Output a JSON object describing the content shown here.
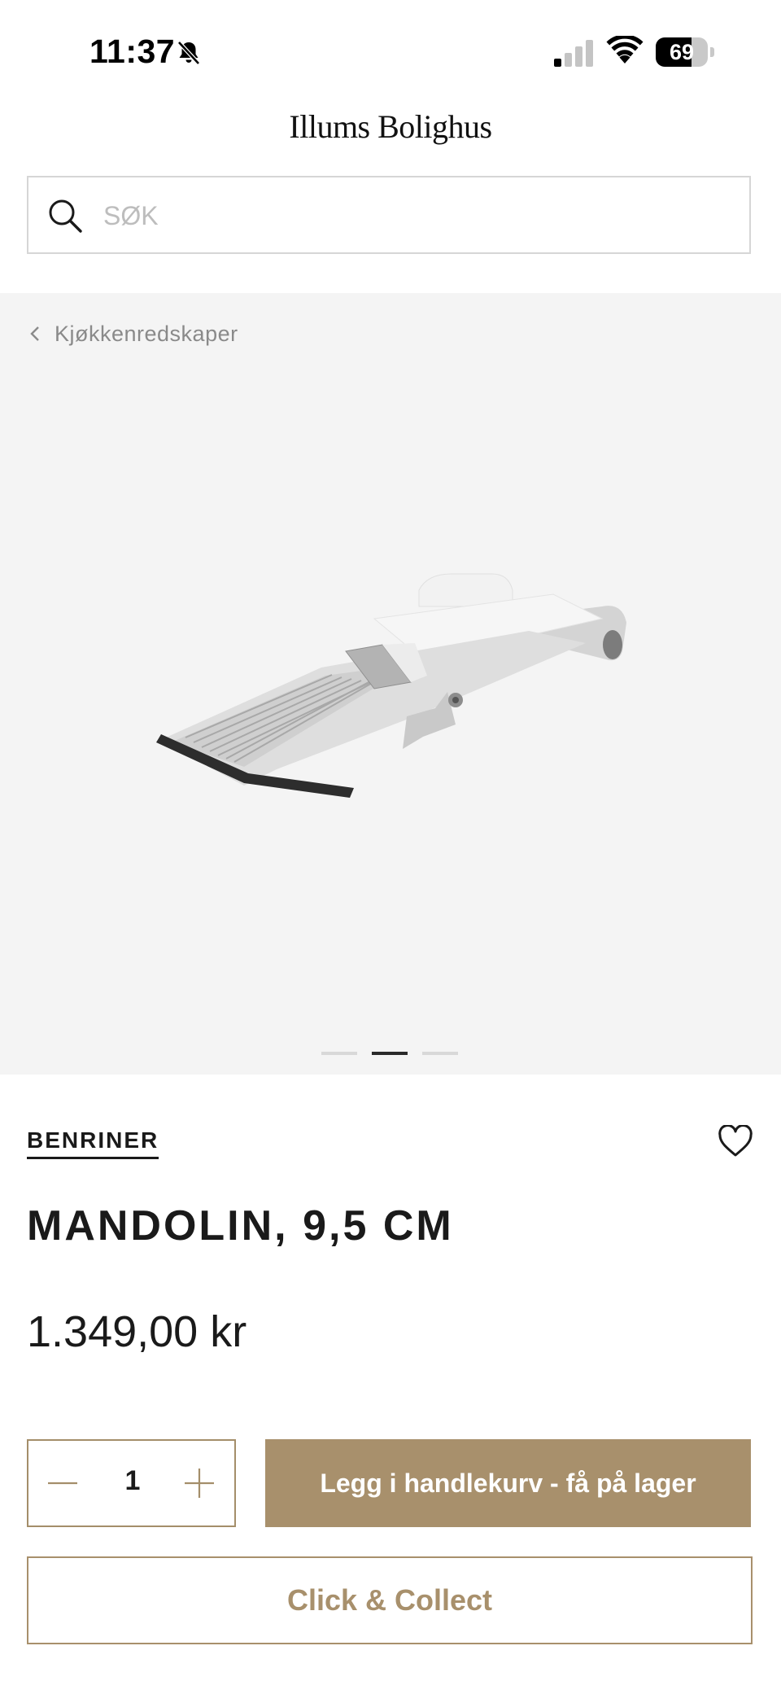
{
  "status_bar": {
    "time": "11:37",
    "battery_level": "69",
    "battery_fraction": 0.69,
    "signal_bars_active": 1,
    "icons": [
      "bell-slash-icon",
      "cellular-signal-icon",
      "wifi-icon",
      "battery-icon"
    ]
  },
  "header": {
    "logo": "Illums Bolighus",
    "search_placeholder": "SØK"
  },
  "breadcrumb": {
    "label": "Kjøkkenredskaper"
  },
  "gallery": {
    "slide_count": 3,
    "active_slide": 2
  },
  "product": {
    "brand": "BENRINER",
    "title": "MANDOLIN, 9,5 CM",
    "price": "1.349,00 kr"
  },
  "actions": {
    "quantity": "1",
    "add_to_cart_label": "Legg i handlekurv - få på lager",
    "click_collect_label": "Click & Collect"
  },
  "colors": {
    "accent": "#a8906c",
    "gallery_background": "#f4f4f4",
    "text": "#1a1a1a"
  }
}
